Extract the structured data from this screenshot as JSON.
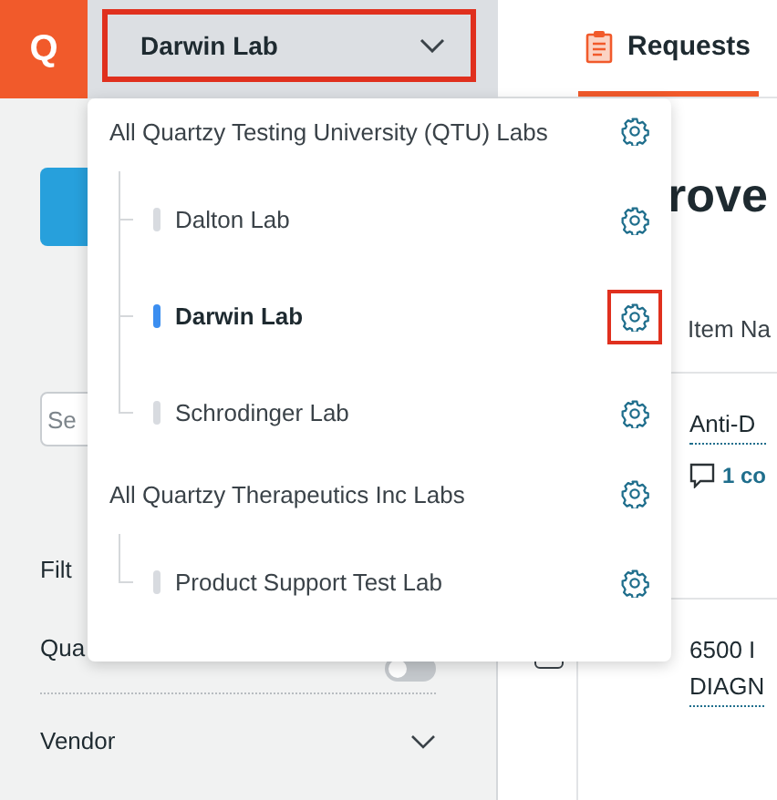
{
  "app": {
    "logo": "Q"
  },
  "lab_selector": {
    "value": "Darwin Lab",
    "highlighted": true
  },
  "nav_tabs": [
    {
      "label": "Requests",
      "selected": true
    }
  ],
  "sidebar": {
    "search": {
      "placeholder": "Se"
    },
    "filters_label": "Filt",
    "toggle_label": "Qua",
    "toggle_on": false,
    "vendor_label": "Vendor"
  },
  "main": {
    "heading": "rove",
    "columns": [
      "Item Na"
    ],
    "rows": [
      {
        "lines": [
          "Anti-D"
        ],
        "comments": "1 co"
      },
      {
        "lines": [
          "6500 I",
          "DIAGN"
        ],
        "checked": false
      }
    ]
  },
  "lab_menu": {
    "groups": [
      {
        "label": "All Quartzy Testing University (QTU) Labs",
        "highlighted": false,
        "children": [
          {
            "label": "Dalton Lab",
            "selected": false,
            "highlighted": false
          },
          {
            "label": "Darwin Lab",
            "selected": true,
            "highlighted": true
          },
          {
            "label": "Schrodinger Lab",
            "selected": false,
            "highlighted": false
          }
        ]
      },
      {
        "label": "All Quartzy Therapeutics Inc Labs",
        "highlighted": false,
        "children": [
          {
            "label": "Product Support Test Lab",
            "selected": false,
            "highlighted": false
          }
        ]
      }
    ]
  }
}
